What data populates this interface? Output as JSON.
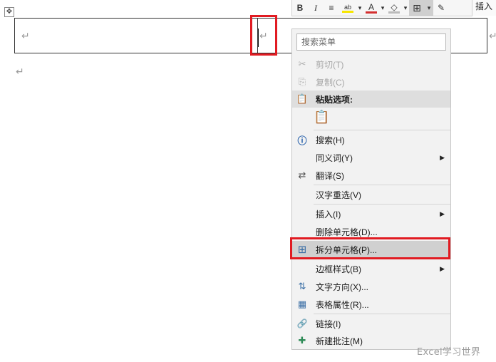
{
  "document": {
    "paragraph_mark": "↵",
    "move_handle_icon": "four-arrow-move",
    "move_handle_glyph": "✥"
  },
  "mini_toolbar": {
    "bold": "B",
    "italic": "I",
    "center_glyph": "≡",
    "highlight_glyph": "ab",
    "font_color_glyph": "A",
    "font_color": "#d32f2f",
    "highlight_color": "#f7e600",
    "shading_glyph": "◇",
    "borders_glyph": "⊞",
    "dropdown_glyph": "▾",
    "brush_glyph": "✎",
    "insert_label": "插入"
  },
  "context_menu": {
    "search_placeholder": "搜索菜单",
    "items": [
      {
        "label": "剪切(T)",
        "icon": "scissors-icon",
        "glyph": "✂",
        "enabled": false
      },
      {
        "label": "复制(C)",
        "icon": "copy-icon",
        "glyph": "⎘",
        "enabled": false
      },
      {
        "label": "粘贴选项:",
        "icon": "paste-icon",
        "glyph": "📋",
        "enabled": true,
        "header": true
      },
      {
        "label": "搜索(H)",
        "icon": "search-icon",
        "glyph": "ⓘ",
        "enabled": true
      },
      {
        "label": "同义词(Y)",
        "icon": "",
        "glyph": "",
        "enabled": true,
        "submenu": true
      },
      {
        "label": "翻译(S)",
        "icon": "translate-icon",
        "glyph": "⇄",
        "enabled": true
      },
      {
        "label": "汉字重选(V)",
        "icon": "",
        "glyph": "",
        "enabled": true
      },
      {
        "label": "插入(I)",
        "icon": "",
        "glyph": "",
        "enabled": true,
        "submenu": true
      },
      {
        "label": "删除单元格(D)...",
        "icon": "",
        "glyph": "",
        "enabled": true
      },
      {
        "label": "拆分单元格(P)...",
        "icon": "split-cells-icon",
        "glyph": "⊞",
        "enabled": true
      },
      {
        "label": "边框样式(B)",
        "icon": "",
        "glyph": "",
        "enabled": true,
        "submenu": true
      },
      {
        "label": "文字方向(X)...",
        "icon": "text-direction-icon",
        "glyph": "⇅",
        "enabled": true
      },
      {
        "label": "表格属性(R)...",
        "icon": "table-properties-icon",
        "glyph": "▦",
        "enabled": true
      },
      {
        "label": "链接(I)",
        "icon": "link-icon",
        "glyph": "🔗",
        "enabled": true
      },
      {
        "label": "新建批注(M)",
        "icon": "new-comment-icon",
        "glyph": "✚",
        "enabled": true
      }
    ],
    "paste_option_glyph": "📋",
    "submenu_arrow": "▶"
  },
  "watermark": "Excel学习世界"
}
